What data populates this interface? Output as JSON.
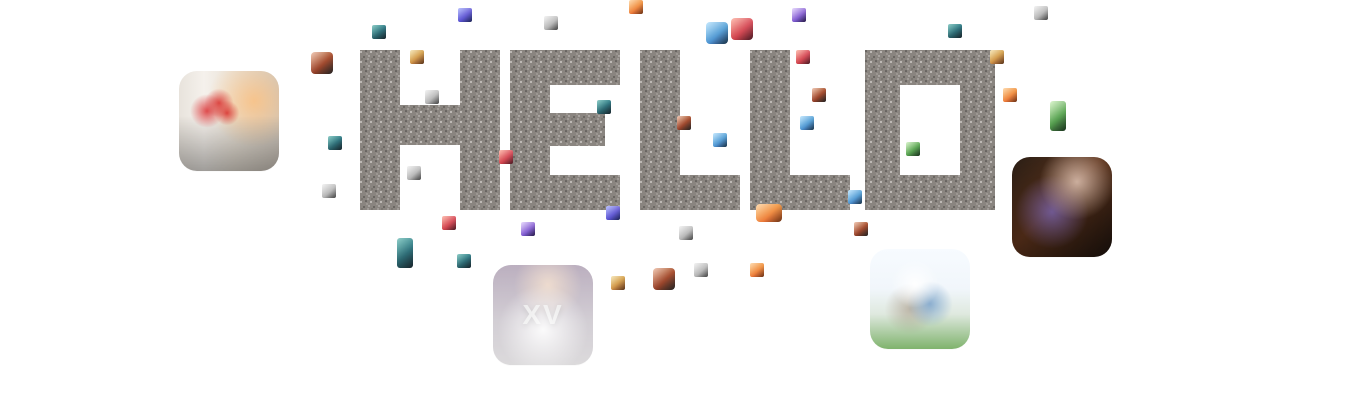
{
  "hero": {
    "word": "HELLO"
  },
  "photos": {
    "big_left_label": "",
    "big_right_label": "",
    "big_bottom_label": "XV",
    "big_couple_label": ""
  },
  "colors": {
    "mosaic_base": "#8a8580",
    "mosaic_light": "#e8e6e3",
    "mosaic_dark": "#2b2928"
  }
}
